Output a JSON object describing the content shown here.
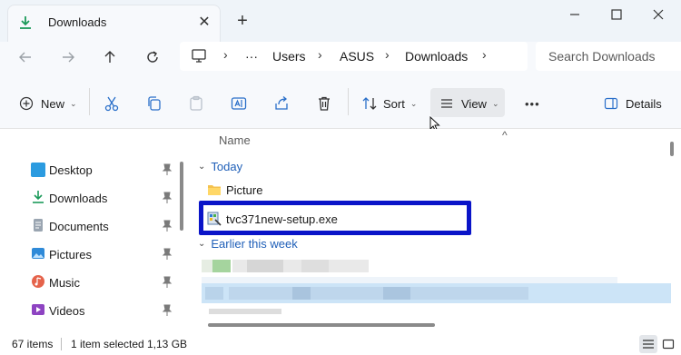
{
  "tab": {
    "title": "Downloads",
    "close_glyph": "✕",
    "new_tab_glyph": "+"
  },
  "address": {
    "segments": [
      "Users",
      "ASUS",
      "Downloads"
    ],
    "ellipsis": "···"
  },
  "search": {
    "placeholder": "Search Downloads"
  },
  "toolbar": {
    "new_label": "New",
    "sort_label": "Sort",
    "view_label": "View",
    "more_label": "•••",
    "details_label": "Details"
  },
  "sidebar": {
    "items": [
      {
        "label": "Desktop",
        "color": "#2b9be0"
      },
      {
        "label": "Downloads",
        "color": "#1c9a5a"
      },
      {
        "label": "Documents",
        "color": "#6d7a8a"
      },
      {
        "label": "Pictures",
        "color": "#2f8ad8"
      },
      {
        "label": "Music",
        "color": "#e5634b"
      },
      {
        "label": "Videos",
        "color": "#8e44c2"
      }
    ]
  },
  "main": {
    "column_name": "Name",
    "sort_glyph": "^",
    "groups": {
      "today": "Today",
      "earlier": "Earlier this week"
    },
    "files": [
      {
        "name": "Picture",
        "icon": "folder-icon"
      },
      {
        "name": "tvc371new-setup.exe",
        "icon": "installer-icon"
      }
    ]
  },
  "status": {
    "items": "67 items",
    "selected": "1 item selected",
    "size": "1,13 GB"
  },
  "colors": {
    "accent": "#1f5fb8",
    "highlight_border": "#0a14c8",
    "selection": "#cce4f7"
  }
}
